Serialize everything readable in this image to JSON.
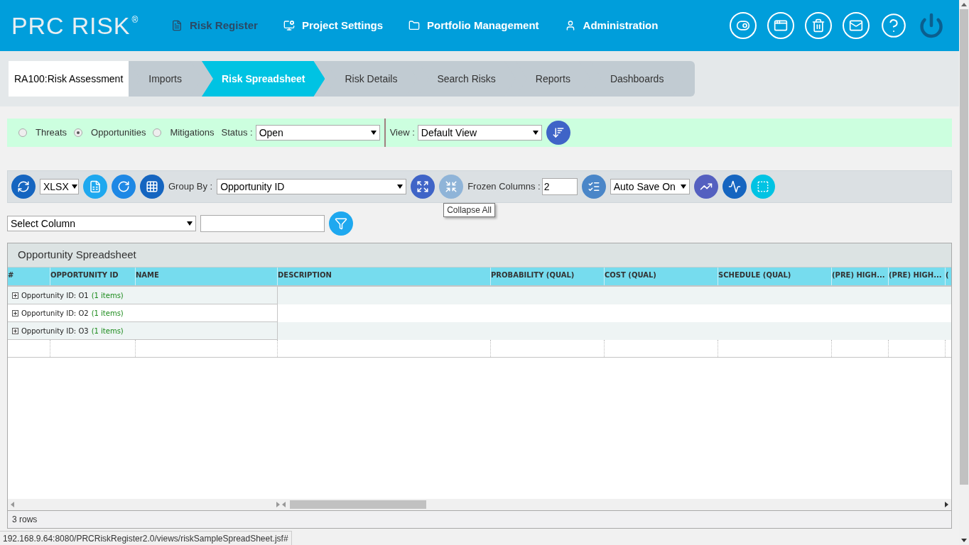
{
  "header": {
    "logo": "PRC RISK",
    "logo_mark": "®",
    "nav": [
      {
        "label": "Risk Register",
        "selected": true,
        "kind": "register"
      },
      {
        "label": "Project Settings",
        "selected": false,
        "kind": "settings"
      },
      {
        "label": "Portfolio Management",
        "selected": false,
        "kind": "portfolio"
      },
      {
        "label": "Administration",
        "selected": false,
        "kind": "admin"
      }
    ]
  },
  "breadcrumb": {
    "project": "RA100:Risk Assessment",
    "steps": [
      {
        "label": "Imports",
        "selected": false
      },
      {
        "label": "Risk Spreadsheet",
        "selected": true
      },
      {
        "label": "Risk Details",
        "selected": false
      },
      {
        "label": "Search Risks",
        "selected": false
      },
      {
        "label": "Reports",
        "selected": false
      },
      {
        "label": "Dashboards",
        "selected": false
      }
    ]
  },
  "filters": {
    "types": [
      {
        "label": "Threats",
        "selected": false
      },
      {
        "label": "Opportunities",
        "selected": true
      },
      {
        "label": "Mitigations",
        "selected": false
      }
    ],
    "status_label": "Status :",
    "status": "Open",
    "view_label": "View :",
    "view": "Default View"
  },
  "toolbar": {
    "format": "XLSX",
    "group_by_label": "Group By :",
    "group_by": "Opportunity ID",
    "collapse_disabled": true,
    "frozen_label": "Frozen Columns :",
    "frozen": "2",
    "autosave": "Auto Save On",
    "tooltip": "Collapse All"
  },
  "column_filter": {
    "column": "Select Column"
  },
  "table": {
    "title": "Opportunity Spreadsheet",
    "columns": [
      "#",
      "OPPORTUNITY ID",
      "NAME",
      "DESCRIPTION",
      "PROBABILITY (QUAL)",
      "COST (QUAL)",
      "SCHEDULE (QUAL)",
      "(PRE) HIGH...",
      "(PRE) HIGH...",
      "("
    ],
    "groups": [
      {
        "label": "Opportunity ID: O1",
        "count": "(1 items)"
      },
      {
        "label": "Opportunity ID: O2",
        "count": "(1 items)"
      },
      {
        "label": "Opportunity ID: O3",
        "count": "(1 items)"
      }
    ],
    "footer": "3 rows"
  },
  "status_bar": "192.168.9.64:8080/PRCRiskRegister2.0/views/riskSampleSpreadSheet.jsf#"
}
